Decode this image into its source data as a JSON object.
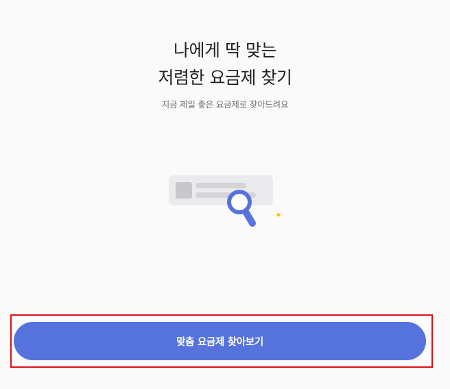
{
  "hero": {
    "title_line1": "나에게 딱 맞는",
    "title_line2": "저렴한 요금제 찾기",
    "subtitle": "지금 제일 좋은 요금제로 찾아드려요"
  },
  "illustration": {
    "icon": "magnifier-search-card-icon",
    "accent_color": "#5572dd",
    "sparkle_color": "#f5b400"
  },
  "cta": {
    "label": "맞춤 요금제 찾아보기",
    "color": "#5572dd",
    "highlight_color": "#e01010"
  }
}
